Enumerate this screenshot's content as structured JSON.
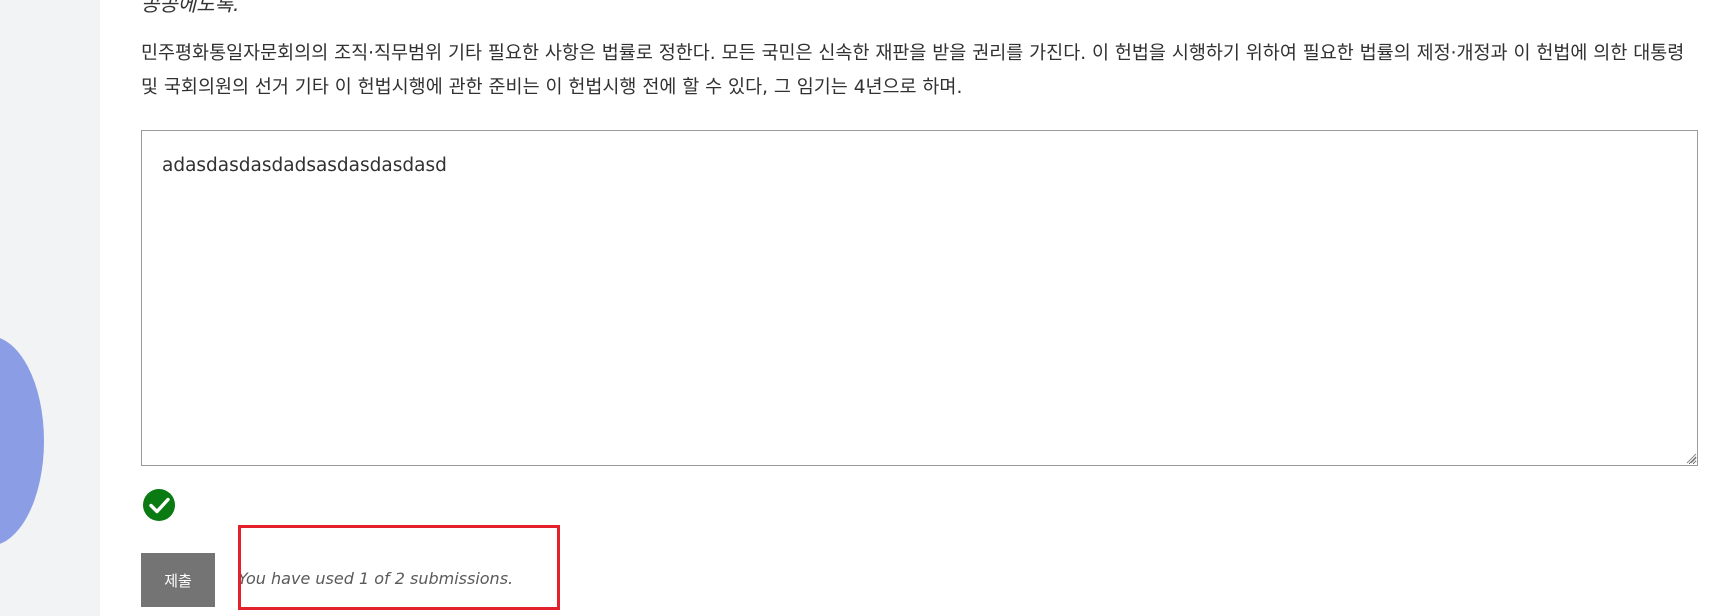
{
  "problem": {
    "previous_line_fragment": "공공에도록.",
    "paragraph": "민주평화통일자문회의의 조직·직무범위 기타 필요한 사항은 법률로 정한다. 모든 국민은 신속한 재판을 받을 권리를 가진다. 이 헌법을 시행하기 위하여 필요한 법률의 제정·개정과 이 헌법에 의한 대통령 및 국회의원의 선거 기타 이 헌법시행에 관한 준비는 이 헌법시행 전에 할 수 있다, 그 임기는 4년으로 하며."
  },
  "answer": {
    "value": "adasdasdasdadsasdasdasdasd"
  },
  "status": {
    "icon": "check-circle-icon",
    "color": "#0a7a12"
  },
  "actions": {
    "submit_label": "제출",
    "submissions_text": "You have used 1 of 2 submissions."
  },
  "annotation": {
    "highlight_color": "#e3212c"
  },
  "colors": {
    "gutter": "#f2f3f5",
    "decor_circle": "#8b9ee5",
    "submit_button": "#747474"
  }
}
